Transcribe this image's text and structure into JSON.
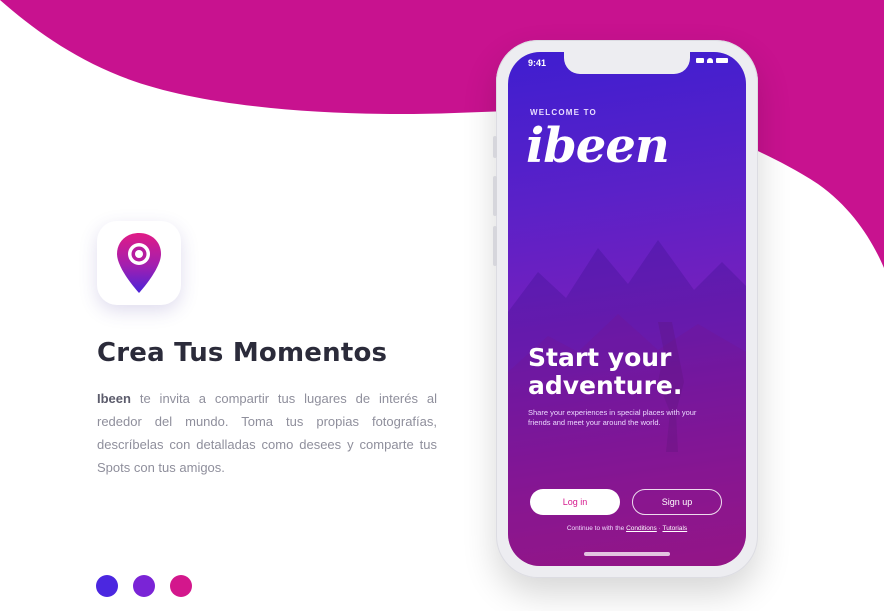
{
  "colors": {
    "brand_magenta": "#c8128f",
    "brand_purple": "#4a24d8",
    "heading_text": "#2b2b3a",
    "body_text": "#8f8f9c"
  },
  "icons": {
    "app_icon": "location-pin-icon"
  },
  "left": {
    "headline": "Crea Tus Momentos",
    "description_brand": "Ibeen",
    "description_rest": "te invita a compartir tus lugares de interés al rededor del mundo. Toma tus propias fotografías, descríbelas con detalladas como desees y comparte tus Spots con tus amigos."
  },
  "pagination": {
    "dots": [
      {
        "color": "#4b27e0"
      },
      {
        "color": "#7a24d6"
      },
      {
        "color": "#d3178c"
      }
    ]
  },
  "phone": {
    "status_time": "9:41",
    "welcome": "WELCOME TO",
    "brand": "ibeen",
    "title_line1": "Start your",
    "title_line2": "adventure.",
    "subtitle": "Share your experiences in special places with your friends and meet your around the world.",
    "login_label": "Log in",
    "signup_label": "Sign up",
    "terms_prefix": "Continue to with the",
    "terms_link1": "Conditions",
    "terms_link2": "Tutorials"
  }
}
